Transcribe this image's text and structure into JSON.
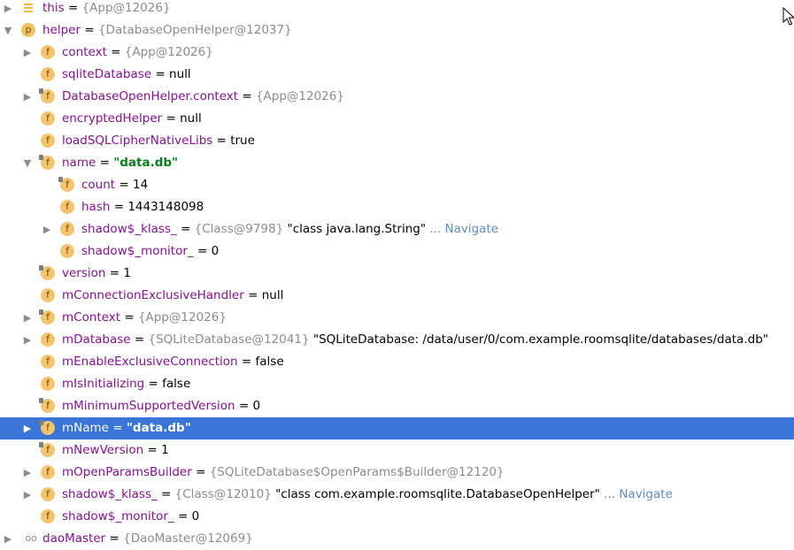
{
  "rows": [
    {
      "indent": 0,
      "expander": "collapsed",
      "icon": "lines-icon",
      "name": "this",
      "sep": " = ",
      "ref": "{App@12026}",
      "str": "",
      "val": "",
      "nav": ""
    },
    {
      "indent": 0,
      "expander": "expanded",
      "icon": "p",
      "name": "helper",
      "sep": " = ",
      "ref": "{DatabaseOpenHelper@12037}",
      "str": "",
      "val": "",
      "nav": ""
    },
    {
      "indent": 1,
      "expander": "collapsed",
      "icon": "f",
      "name": "context",
      "sep": " = ",
      "ref": "{App@12026}",
      "str": "",
      "val": "",
      "nav": ""
    },
    {
      "indent": 1,
      "expander": "none",
      "icon": "f",
      "name": "sqliteDatabase",
      "sep": " = ",
      "ref": "",
      "str": "",
      "val": "null",
      "nav": ""
    },
    {
      "indent": 1,
      "expander": "collapsed",
      "icon": "f-lock",
      "name": "DatabaseOpenHelper.context",
      "sep": " = ",
      "ref": "{App@12026}",
      "str": "",
      "val": "",
      "nav": ""
    },
    {
      "indent": 1,
      "expander": "none",
      "icon": "f",
      "name": "encryptedHelper",
      "sep": " = ",
      "ref": "",
      "str": "",
      "val": "null",
      "nav": ""
    },
    {
      "indent": 1,
      "expander": "none",
      "icon": "f",
      "name": "loadSQLCipherNativeLibs",
      "sep": " = ",
      "ref": "",
      "str": "",
      "val": "true",
      "nav": ""
    },
    {
      "indent": 1,
      "expander": "expanded",
      "icon": "f-lock",
      "name": "name",
      "sep": " = ",
      "ref": "",
      "str": "\"data.db\"",
      "val": "",
      "nav": ""
    },
    {
      "indent": 2,
      "expander": "none",
      "icon": "f-lock",
      "name": "count",
      "sep": " = ",
      "ref": "",
      "str": "",
      "val": "14",
      "nav": ""
    },
    {
      "indent": 2,
      "expander": "none",
      "icon": "f",
      "name": "hash",
      "sep": " = ",
      "ref": "",
      "str": "",
      "val": "1443148098",
      "nav": ""
    },
    {
      "indent": 2,
      "expander": "collapsed",
      "icon": "f",
      "name": "shadow$_klass_",
      "sep": " = ",
      "ref": "{Class@9798}",
      "str": "",
      "val": "\"class java.lang.String\"",
      "nav": "... Navigate"
    },
    {
      "indent": 2,
      "expander": "none",
      "icon": "f",
      "name": "shadow$_monitor_",
      "sep": " = ",
      "ref": "",
      "str": "",
      "val": "0",
      "nav": ""
    },
    {
      "indent": 1,
      "expander": "none",
      "icon": "f-lock",
      "name": "version",
      "sep": " = ",
      "ref": "",
      "str": "",
      "val": "1",
      "nav": ""
    },
    {
      "indent": 1,
      "expander": "none",
      "icon": "f",
      "name": "mConnectionExclusiveHandler",
      "sep": " = ",
      "ref": "",
      "str": "",
      "val": "null",
      "nav": ""
    },
    {
      "indent": 1,
      "expander": "collapsed",
      "icon": "f-lock",
      "name": "mContext",
      "sep": " = ",
      "ref": "{App@12026}",
      "str": "",
      "val": "",
      "nav": ""
    },
    {
      "indent": 1,
      "expander": "collapsed",
      "icon": "f",
      "name": "mDatabase",
      "sep": " = ",
      "ref": "{SQLiteDatabase@12041}",
      "str": "",
      "val": "\"SQLiteDatabase: /data/user/0/com.example.roomsqlite/databases/data.db\"",
      "nav": ""
    },
    {
      "indent": 1,
      "expander": "none",
      "icon": "f",
      "name": "mEnableExclusiveConnection",
      "sep": " = ",
      "ref": "",
      "str": "",
      "val": "false",
      "nav": ""
    },
    {
      "indent": 1,
      "expander": "none",
      "icon": "f",
      "name": "mIsInitializing",
      "sep": " = ",
      "ref": "",
      "str": "",
      "val": "false",
      "nav": ""
    },
    {
      "indent": 1,
      "expander": "none",
      "icon": "f-lock",
      "name": "mMinimumSupportedVersion",
      "sep": " = ",
      "ref": "",
      "str": "",
      "val": "0",
      "nav": ""
    },
    {
      "indent": 1,
      "expander": "collapsed",
      "icon": "f-lock",
      "name": "mName",
      "sep": " = ",
      "ref": "",
      "str": "\"data.db\"",
      "val": "",
      "nav": "",
      "selected": true
    },
    {
      "indent": 1,
      "expander": "none",
      "icon": "f-lock",
      "name": "mNewVersion",
      "sep": " = ",
      "ref": "",
      "str": "",
      "val": "1",
      "nav": ""
    },
    {
      "indent": 1,
      "expander": "collapsed",
      "icon": "f",
      "name": "mOpenParamsBuilder",
      "sep": " = ",
      "ref": "{SQLiteDatabase$OpenParams$Builder@12120}",
      "str": "",
      "val": "",
      "nav": ""
    },
    {
      "indent": 1,
      "expander": "collapsed",
      "icon": "f",
      "name": "shadow$_klass_",
      "sep": " = ",
      "ref": "{Class@12010}",
      "str": "",
      "val": "\"class com.example.roomsqlite.DatabaseOpenHelper\"",
      "nav": "... Navigate"
    },
    {
      "indent": 1,
      "expander": "none",
      "icon": "f",
      "name": "shadow$_monitor_",
      "sep": " = ",
      "ref": "",
      "str": "",
      "val": "0",
      "nav": ""
    },
    {
      "indent": 0,
      "expander": "collapsed",
      "icon": "glasses-icon",
      "name": "daoMaster",
      "sep": " = ",
      "ref": "{DaoMaster@12069}",
      "str": "",
      "val": "",
      "nav": ""
    }
  ],
  "icon_letters": {
    "field": "f",
    "param": "p",
    "watch": "oo"
  },
  "expander_glyphs": {
    "collapsed": "▶",
    "expanded": "▼"
  },
  "colors": {
    "selection": "#3875d7",
    "name": "#871094",
    "object_ref": "#8c8c8c",
    "string": "#067d17",
    "navigate_link": "#5e8dbf",
    "field_icon": "#f4c56e"
  }
}
